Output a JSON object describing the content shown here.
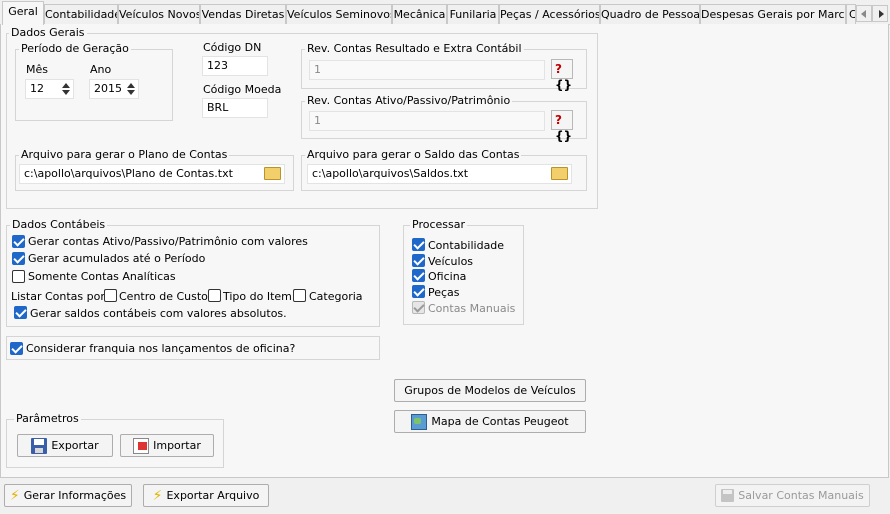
{
  "tabs": [
    {
      "label": "Geral",
      "active": true
    },
    {
      "label": "Contabilidade"
    },
    {
      "label": "Veículos Novos"
    },
    {
      "label": "Vendas Diretas"
    },
    {
      "label": "Veículos Seminovos"
    },
    {
      "label": "Mecânica"
    },
    {
      "label": "Funilaria"
    },
    {
      "label": "Peças / Acessórios"
    },
    {
      "label": "Quadro de Pessoal"
    },
    {
      "label": "Despesas Gerais por Marca"
    },
    {
      "label": "C"
    }
  ],
  "dados_gerais": {
    "title": "Dados Gerais",
    "periodo": {
      "title": "Período de Geração",
      "mes_label": "Mês",
      "mes_value": "12",
      "ano_label": "Ano",
      "ano_value": "2015"
    },
    "codigo_dn_label": "Código DN",
    "codigo_dn_value": "123",
    "codigo_moeda_label": "Código Moeda",
    "codigo_moeda_value": "BRL",
    "rev_resultado": {
      "title": "Rev. Contas Resultado e Extra Contábil",
      "value": "1"
    },
    "rev_ativo": {
      "title": "Rev. Contas Ativo/Passivo/Patrimônio",
      "value": "1"
    },
    "arquivo_plano": {
      "title": "Arquivo para gerar o Plano de Contas",
      "value": "c:\\apollo\\arquivos\\Plano de Contas.txt"
    },
    "arquivo_saldo": {
      "title": "Arquivo para gerar o Saldo das Contas",
      "value": "c:\\apollo\\arquivos\\Saldos.txt"
    }
  },
  "dados_contabeis": {
    "title": "Dados Contábeis",
    "gerar_contas": "Gerar contas Ativo/Passivo/Patrimônio com valores",
    "gerar_acumulados": "Gerar acumulados até o Período",
    "somente_analiticas": "Somente Contas Analíticas",
    "listar_label": "Listar Contas por:",
    "centro_custo": "Centro de Custo",
    "tipo_item": "Tipo do Item",
    "categoria": "Categoria",
    "saldos_absolutos": "Gerar saldos contábeis com valores absolutos."
  },
  "franquia": "Considerar franquia nos lançamentos de oficina?",
  "processar": {
    "title": "Processar",
    "items": [
      "Contabilidade",
      "Veículos",
      "Oficina",
      "Peças",
      "Contas Manuais"
    ]
  },
  "buttons": {
    "grupos_modelos": "Grupos de Modelos de Veículos",
    "mapa_contas": "Mapa de Contas Peugeot",
    "exportar": "Exportar",
    "importar": "Importar",
    "gerar_informacoes": "Gerar Informações",
    "exportar_arquivo": "Exportar Arquivo",
    "salvar_manuais": "Salvar Contas Manuais"
  },
  "parametros_title": "Parâmetros",
  "colors": {
    "check_blue": "#1f67c9",
    "border": "#c8c8c8",
    "panel": "#f7f7f7"
  }
}
